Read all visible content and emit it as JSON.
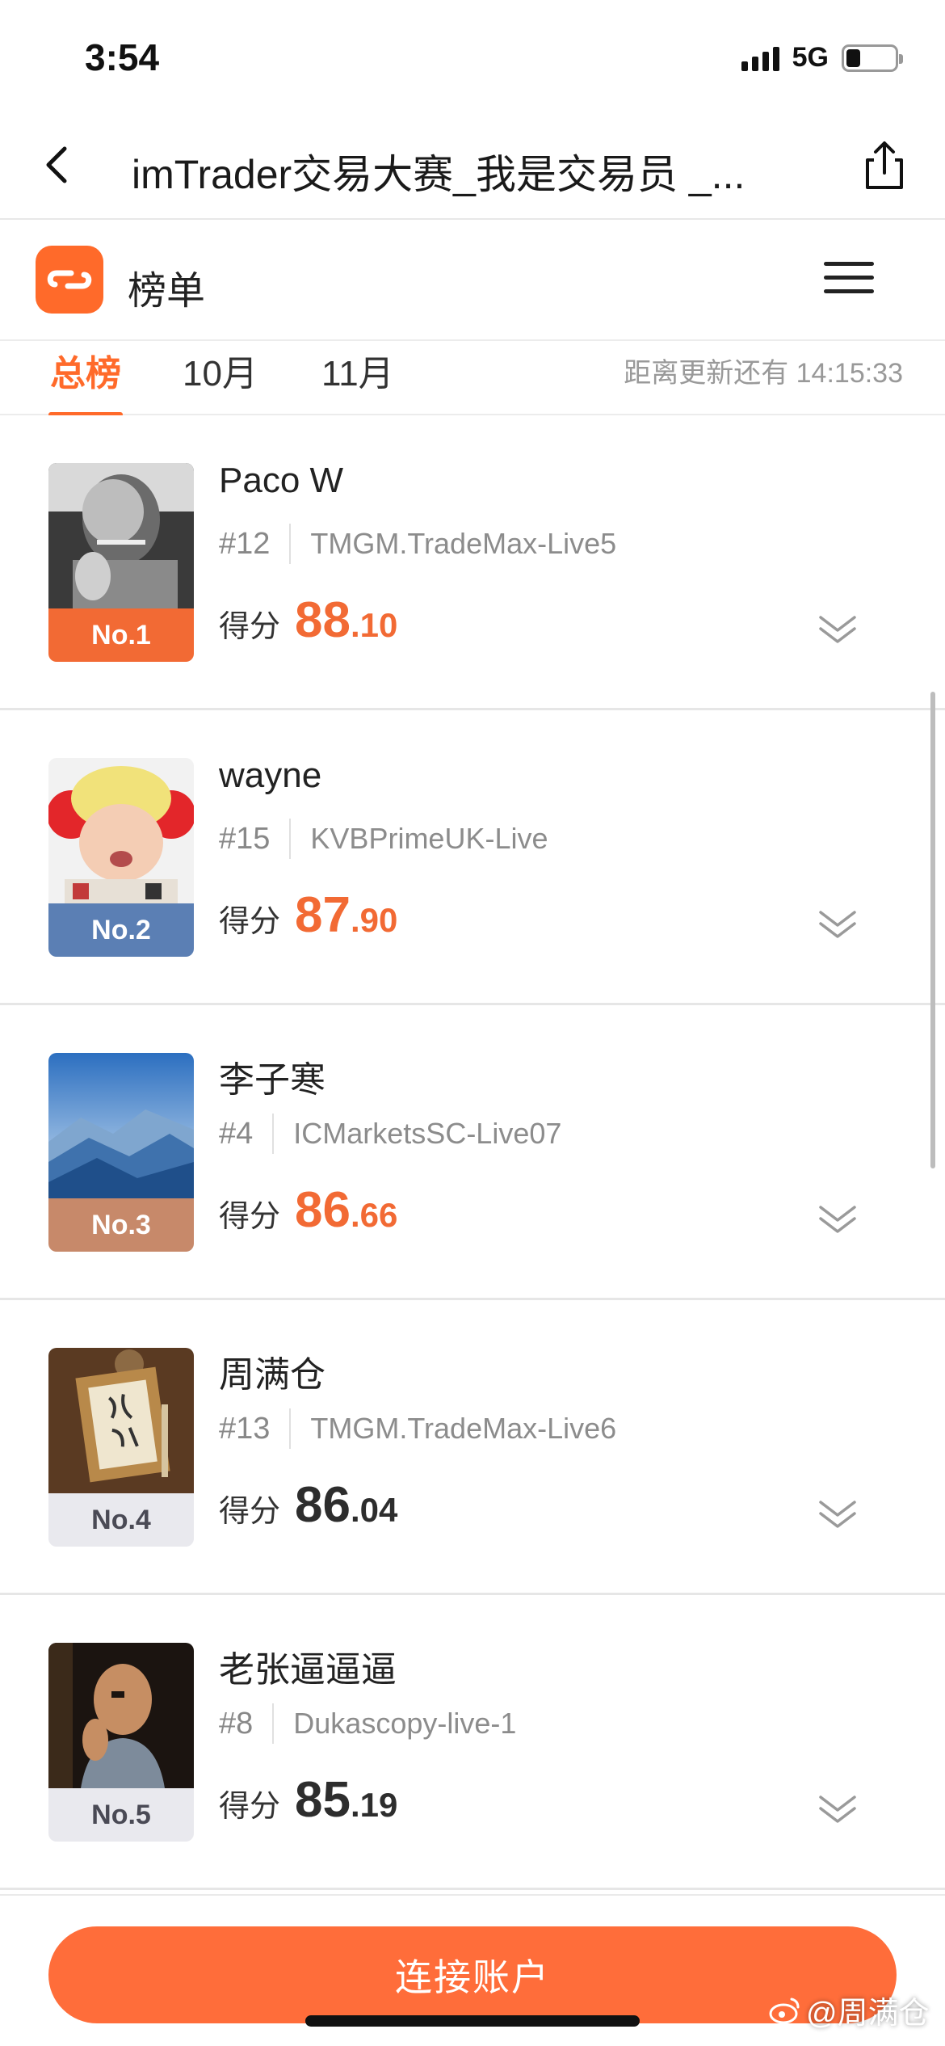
{
  "status_bar": {
    "time": "3:54",
    "network": "5G",
    "battery_level": 0.3
  },
  "nav": {
    "title": "imTrader交易大赛_我是交易员 _...",
    "back_icon": "chevron-left-icon",
    "share_icon": "share-icon"
  },
  "header": {
    "title": "榜单",
    "logo_icon": "imtrader-logo-icon",
    "menu_icon": "hamburger-menu-icon"
  },
  "tabs": [
    {
      "label": "总榜",
      "active": true
    },
    {
      "label": "10月",
      "active": false
    },
    {
      "label": "11月",
      "active": false
    }
  ],
  "update_text": "距离更新还有 14:15:33",
  "score_label": "得分",
  "entries": [
    {
      "badge": "No.1",
      "name": "Paco W",
      "rank_no": "#12",
      "server": "TMGM.TradeMax-Live5",
      "score_int": "88",
      "score_dec": ".10",
      "badge_color": "#f26a34",
      "avatar": "portrait-smoking-man"
    },
    {
      "badge": "No.2",
      "name": "wayne",
      "rank_no": "#15",
      "server": "KVBPrimeUK-Live",
      "score_int": "87",
      "score_dec": ".90",
      "badge_color": "#5b7fb4",
      "avatar": "baby-red-hat"
    },
    {
      "badge": "No.3",
      "name": "李子寒",
      "rank_no": "#4",
      "server": "ICMarketsSC-Live07",
      "score_int": "86",
      "score_dec": ".66",
      "badge_color": "#c7896a",
      "avatar": "blue-mountains"
    },
    {
      "badge": "No.4",
      "name": "周满仓",
      "rank_no": "#13",
      "server": "TMGM.TradeMax-Live6",
      "score_int": "86",
      "score_dec": ".04",
      "badge_color": "#e9e9ee",
      "avatar": "calligraphy-frame"
    },
    {
      "badge": "No.5",
      "name": "老张逼逼逼",
      "rank_no": "#8",
      "server": "Dukascopy-live-1",
      "score_int": "85",
      "score_dec": ".19",
      "badge_color": "#e9e9ee",
      "avatar": "man-movie-still"
    }
  ],
  "connect_button": "连接账户",
  "watermark": "@周满仓",
  "colors": {
    "accent": "#ff6a2a",
    "score_top3": "#f26a34",
    "score_other": "#2d2d2d"
  }
}
